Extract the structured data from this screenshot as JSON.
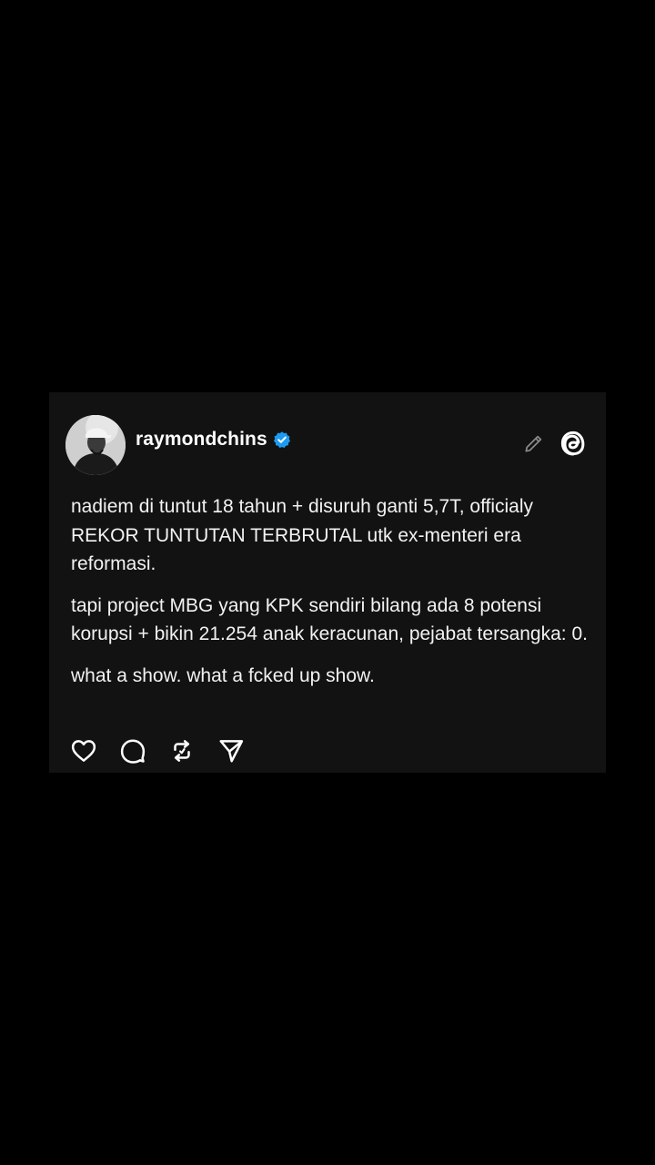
{
  "post": {
    "username": "raymondchins",
    "verified": true,
    "paragraphs": [
      "nadiem di tuntut 18 tahun + disuruh ganti 5,7T, officialy REKOR TUNTUTAN TERBRUTAL utk ex-menteri era reformasi.",
      "tapi project MBG yang KPK sendiri bilang ada 8 potensi korupsi + bikin 21.254 anak keracunan, pejabat tersangka: 0.",
      "what a show. what a fcked up show."
    ],
    "header_icons": [
      "edit-icon",
      "threads-logo-icon"
    ],
    "actions": [
      "heart-icon",
      "comment-icon",
      "repost-icon",
      "share-icon"
    ]
  },
  "colors": {
    "background": "#000000",
    "card": "#121212",
    "text": "#f2f2f2",
    "verified": "#1d9bf0"
  }
}
